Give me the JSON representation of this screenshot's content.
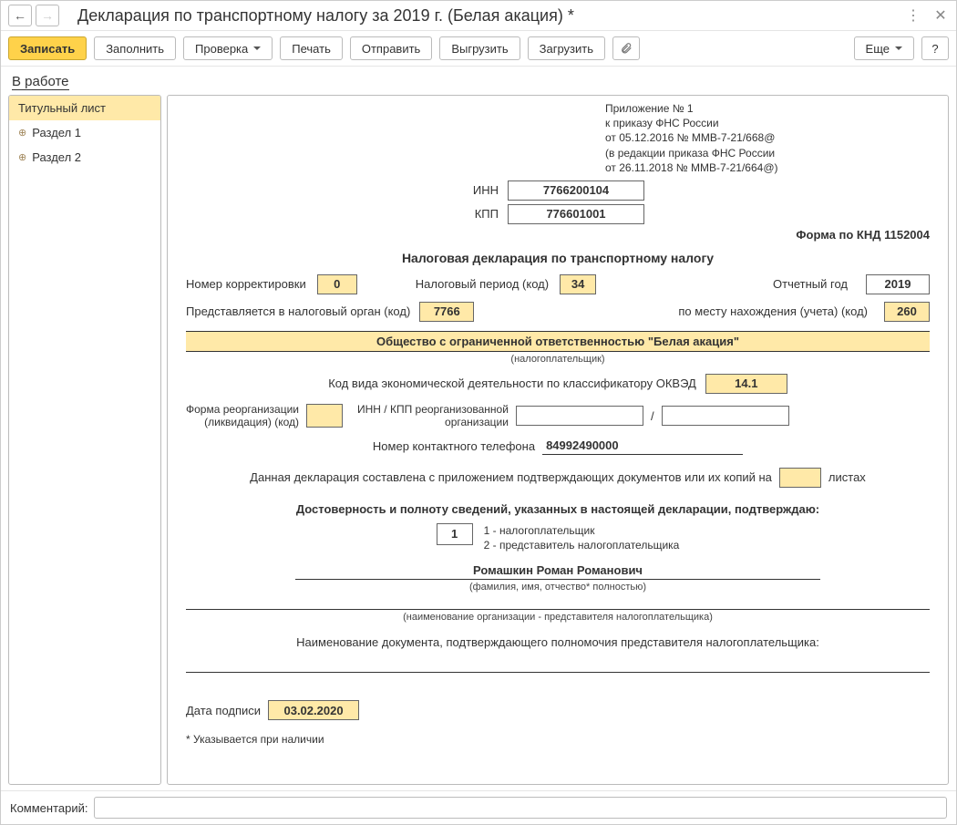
{
  "window": {
    "title": "Декларация по транспортному налогу за 2019 г. (Белая акация) *"
  },
  "toolbar": {
    "save": "Записать",
    "fill": "Заполнить",
    "check": "Проверка",
    "print": "Печать",
    "send": "Отправить",
    "export": "Выгрузить",
    "import": "Загрузить",
    "more": "Еще",
    "help": "?"
  },
  "status": {
    "text": "В работе"
  },
  "tree": {
    "title_page": "Титульный лист",
    "section1": "Раздел 1",
    "section2": "Раздел 2"
  },
  "appendix": {
    "l1": "Приложение № 1",
    "l2": "к приказу ФНС России",
    "l3": "от 05.12.2016 № ММВ-7-21/668@",
    "l4": "(в редакции приказа ФНС России",
    "l5": "от 26.11.2018 № ММВ-7-21/664@)"
  },
  "doc": {
    "inn_label": "ИНН",
    "inn": "7766200104",
    "kpp_label": "КПП",
    "kpp": "776601001",
    "knd_label": "Форма по КНД 1152004",
    "title": "Налоговая декларация по транспортному налогу",
    "corr_label": "Номер корректировки",
    "corr": "0",
    "period_label": "Налоговый период (код)",
    "period": "34",
    "year_label": "Отчетный год",
    "year": "2019",
    "organ_label": "Представляется в налоговый орган (код)",
    "organ": "7766",
    "place_label": "по месту нахождения (учета) (код)",
    "place": "260",
    "org_name": "Общество с ограниченной ответственностью \"Белая акация\"",
    "org_sub": "(налогоплательщик)",
    "okved_label": "Код вида экономической деятельности по классификатору ОКВЭД",
    "okved": "14.1",
    "reorg_form_label_l1": "Форма реорганизации",
    "reorg_form_label_l2": "(ликвидация) (код)",
    "reorg_inn_label_l1": "ИНН / КПП реорганизованной",
    "reorg_inn_label_l2": "организации",
    "slash": "/",
    "phone_label": "Номер контактного телефона",
    "phone": "84992490000",
    "pages_text1": "Данная декларация составлена с приложением подтверждающих документов или их копий на",
    "pages_text2": "листах",
    "confirm_title": "Достоверность и полноту сведений, указанных в настоящей декларации, подтверждаю:",
    "conf_val": "1",
    "conf_opt1": "1 - налогоплательщик",
    "conf_opt2": "2 - представитель налогоплательщика",
    "person_name": "Ромашкин Роман Романович",
    "person_sub": "(фамилия, имя, отчество* полностью)",
    "rep_org_sub": "(наименование организации - представителя налогоплательщика)",
    "rep_doc_label": "Наименование документа, подтверждающего полномочия представителя налогоплательщика:",
    "sign_date_label": "Дата подписи",
    "sign_date": "03.02.2020",
    "footnote": "* Указывается при наличии"
  },
  "footer": {
    "label": "Комментарий:"
  }
}
